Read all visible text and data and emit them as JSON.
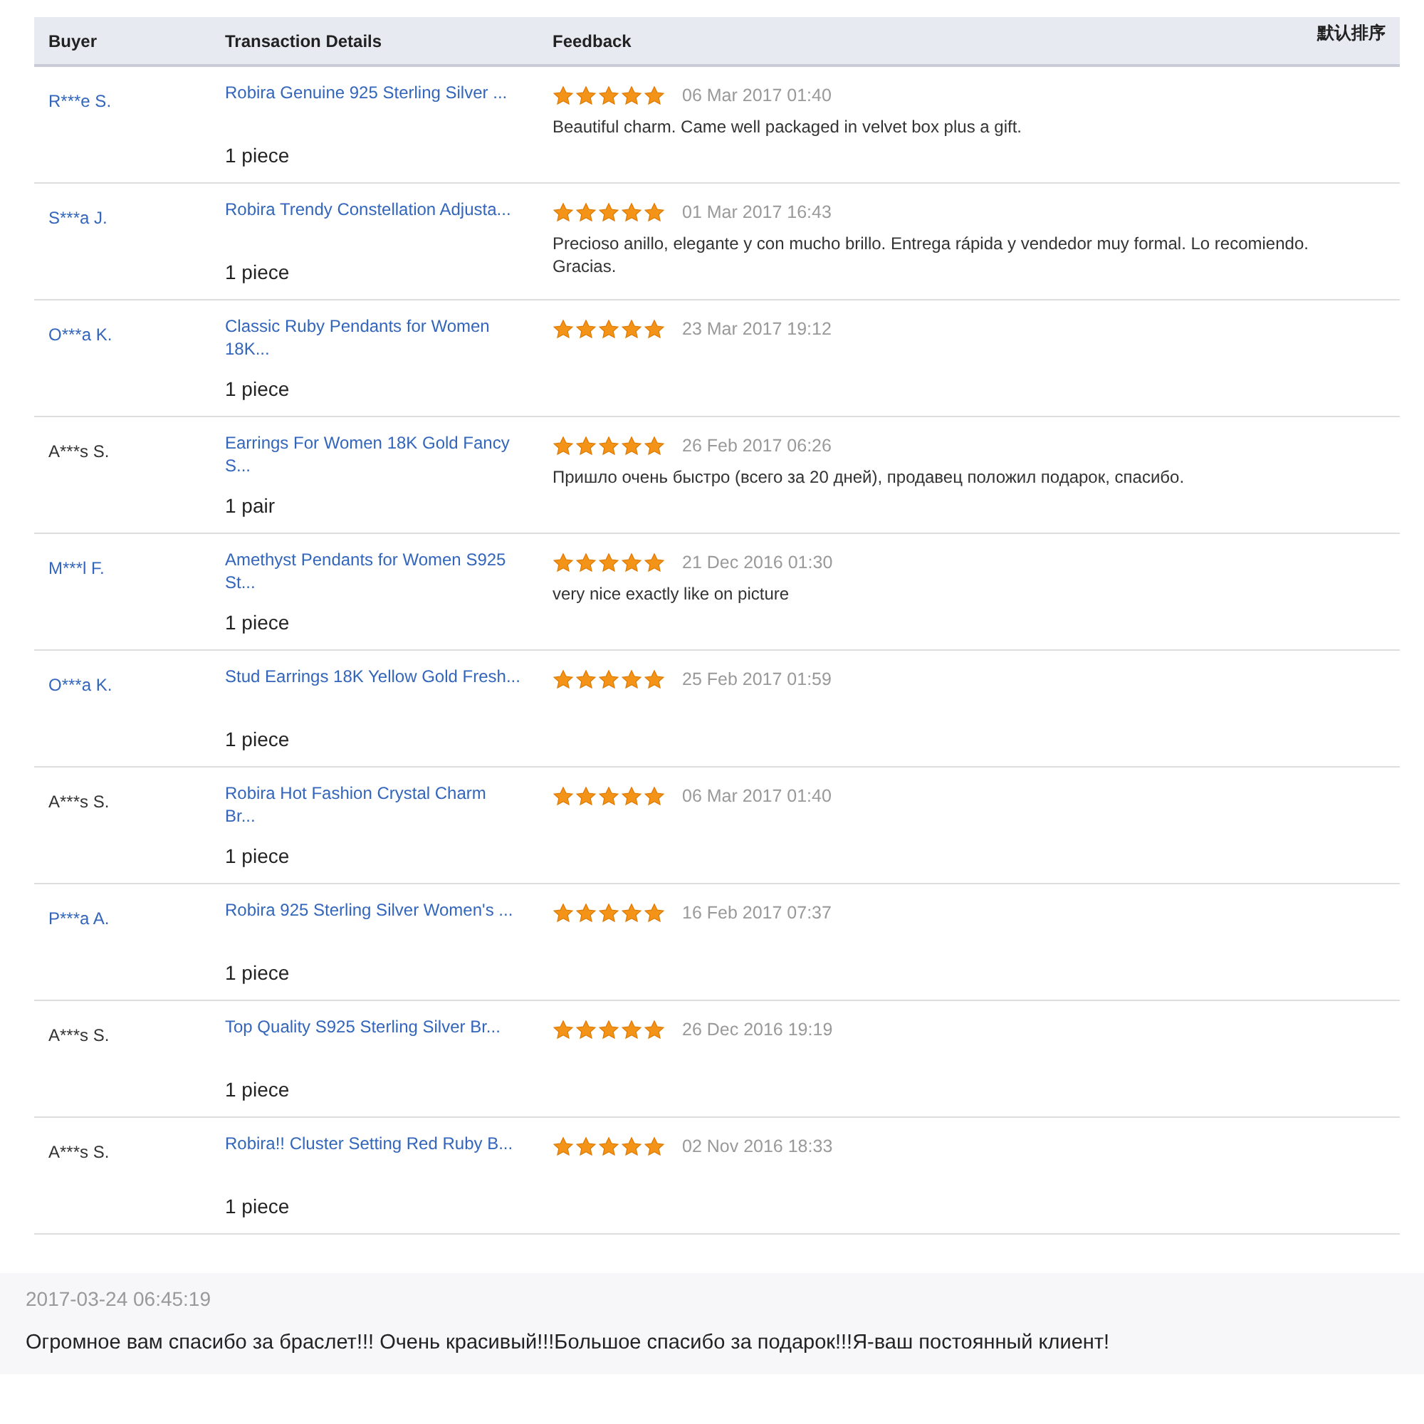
{
  "table": {
    "columns": [
      "Buyer",
      "Transaction Details",
      "Feedback"
    ],
    "sort_label": "默认排序",
    "rows": [
      {
        "buyer": "R***e S.",
        "buyer_link": true,
        "product": "Robira Genuine 925 Sterling Silver ...",
        "quantity": "1 piece",
        "stars": 5,
        "date": "06 Mar 2017 01:40",
        "comment": "Beautiful charm. Came well packaged in velvet box plus a gift."
      },
      {
        "buyer": "S***a J.",
        "buyer_link": true,
        "product": "Robira Trendy Constellation Adjusta...",
        "quantity": "1 piece",
        "stars": 5,
        "date": "01 Mar 2017 16:43",
        "comment": "Precioso anillo, elegante y con mucho brillo. Entrega rápida y vendedor muy formal. Lo recomiendo. Gracias."
      },
      {
        "buyer": "O***a K.",
        "buyer_link": true,
        "product": "Classic Ruby Pendants for Women 18K...",
        "quantity": "1 piece",
        "stars": 5,
        "date": "23 Mar 2017 19:12"
      },
      {
        "buyer": "A***s S.",
        "buyer_link": false,
        "product": "Earrings For Women 18K Gold Fancy S...",
        "quantity": "1 pair",
        "stars": 5,
        "date": "26 Feb 2017 06:26",
        "comment": "Пришло очень быстро (всего за 20 дней), продавец положил подарок, спасибо."
      },
      {
        "buyer": "M***l F.",
        "buyer_link": true,
        "product": "Amethyst Pendants for Women S925 St...",
        "quantity": "1 piece",
        "stars": 5,
        "date": "21 Dec 2016 01:30",
        "comment": "very nice exactly like on picture"
      },
      {
        "buyer": "O***a K.",
        "buyer_link": true,
        "product": "Stud Earrings 18K Yellow Gold Fresh...",
        "quantity": "1 piece",
        "stars": 5,
        "date": "25 Feb 2017 01:59"
      },
      {
        "buyer": "A***s S.",
        "buyer_link": false,
        "product": "Robira Hot Fashion Crystal Charm Br...",
        "quantity": "1 piece",
        "stars": 5,
        "date": "06 Mar 2017 01:40"
      },
      {
        "buyer": "P***a A.",
        "buyer_link": true,
        "product": "Robira 925 Sterling Silver Women's ...",
        "quantity": "1 piece",
        "stars": 5,
        "date": "16 Feb 2017 07:37"
      },
      {
        "buyer": "A***s S.",
        "buyer_link": false,
        "product": "Top Quality S925 Sterling Silver Br...",
        "quantity": "1 piece",
        "stars": 5,
        "date": "26 Dec 2016 19:19"
      },
      {
        "buyer": "A***s S.",
        "buyer_link": false,
        "product": "Robira!! Cluster Setting Red Ruby B...",
        "quantity": "1 piece",
        "stars": 5,
        "date": "02 Nov 2016 18:33"
      }
    ]
  },
  "review": {
    "timestamp": "2017-03-24 06:45:19",
    "text": "Огромное вам спасибо за браслет!!! Очень красивый!!!Большое спасибо за подарок!!!Я-ваш постоянный клиент!"
  }
}
